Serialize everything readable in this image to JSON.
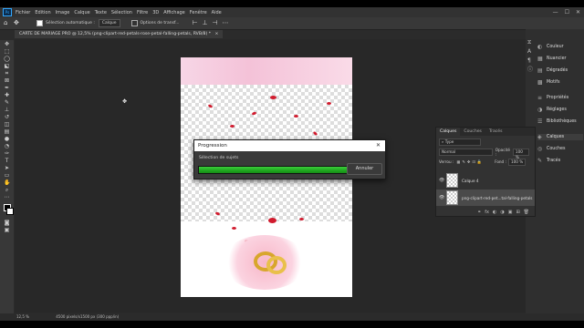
{
  "app": {
    "logo": "Ps",
    "menu": [
      "Fichier",
      "Edition",
      "Image",
      "Calque",
      "Texte",
      "Sélection",
      "Filtre",
      "3D",
      "Affichage",
      "Fenêtre",
      "Aide"
    ],
    "window_controls": [
      "—",
      "☐",
      "✕"
    ]
  },
  "options_bar": {
    "auto_select_label": "Sélection automatique :",
    "auto_select_value": "Calque",
    "transform_label": "Options de transf..."
  },
  "document_tab": {
    "title": "CARTE DE MARIAGE PRO @ 12,5% (png-clipart-red-petals-rose-petal-falling-petals, RVB/8) *",
    "close": "×"
  },
  "status_bar": {
    "zoom": "12,5 %",
    "doc_info": "4500 pixels/x1500 px (300 ppp/in)"
  },
  "right_panels": [
    {
      "icon": "color-icon",
      "glyph": "◐",
      "label": "Couleur"
    },
    {
      "icon": "swatches-icon",
      "glyph": "▦",
      "label": "Nuancier"
    },
    {
      "icon": "gradient-icon",
      "glyph": "▤",
      "label": "Dégradés"
    },
    {
      "icon": "pattern-icon",
      "glyph": "▩",
      "label": "Motifs"
    },
    {
      "icon": "properties-icon",
      "glyph": "≡",
      "label": "Propriétés"
    },
    {
      "icon": "adjustments-icon",
      "glyph": "◑",
      "label": "Réglages"
    },
    {
      "icon": "libraries-icon",
      "glyph": "☰",
      "label": "Bibliothèques"
    },
    {
      "icon": "layers-icon",
      "glyph": "◈",
      "label": "Calques"
    },
    {
      "icon": "channels-icon",
      "glyph": "◎",
      "label": "Couches"
    },
    {
      "icon": "paths-icon",
      "glyph": "✎",
      "label": "Tracés"
    }
  ],
  "layers_panel": {
    "tabs": [
      "Calques",
      "Couches",
      "Tracés"
    ],
    "filter_label": "Type",
    "blend_mode": "Normal",
    "opacity_label": "Opacité :",
    "opacity_value": "100 %",
    "lock_label": "Verrou :",
    "fill_label": "Fond :",
    "fill_value": "100 %",
    "layers": [
      {
        "name": "Calque 4"
      },
      {
        "name": "png-clipart-red-pet...tal-falling-petals"
      }
    ],
    "footer_icons": [
      "⚭",
      "fx",
      "◐",
      "◑",
      "▣",
      "⊞",
      "🗑"
    ]
  },
  "dialog": {
    "title": "Progression",
    "message": "Sélection de sujets",
    "progress": 0.98,
    "cancel_label": "Annuler",
    "close_glyph": "✕"
  }
}
